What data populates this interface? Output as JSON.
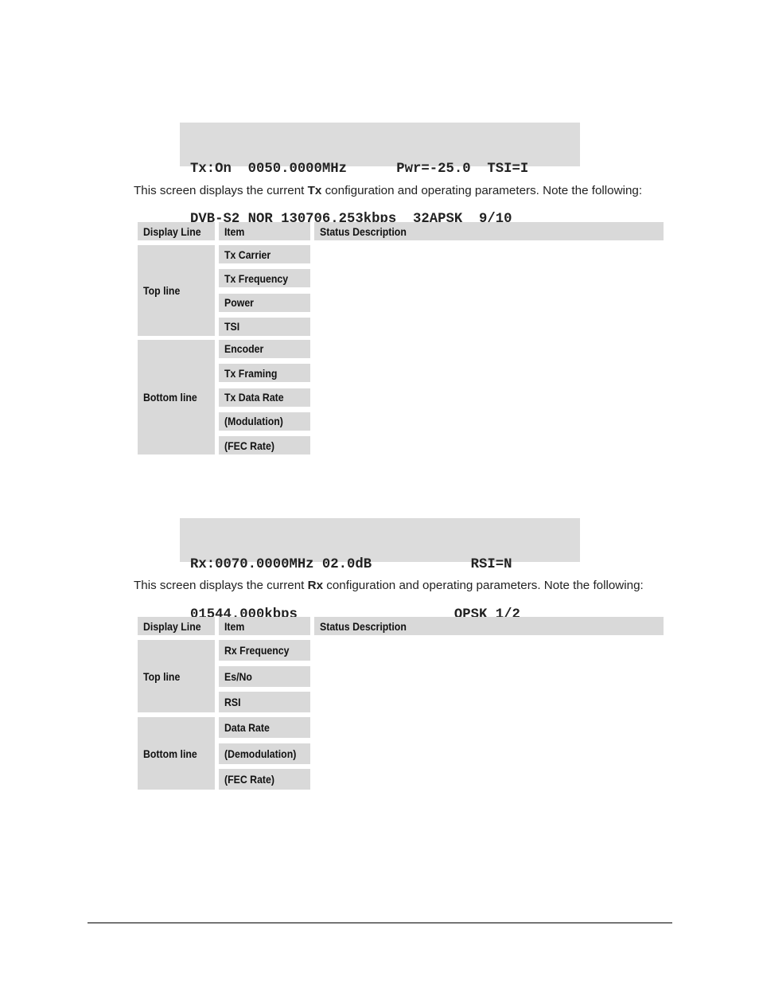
{
  "tx_screen": {
    "lcd_lines": [
      "Tx:On  0050.0000MHz      Pwr=-25.0  TSI=I",
      "DVB-S2 NOR 130706.253kbps  32APSK  9/10"
    ],
    "para_before": "This screen displays the current ",
    "para_bold": "Tx",
    "para_after": " configuration and operating parameters. Note the following:",
    "table": {
      "headers": [
        "Display Line",
        "Item",
        "Status Description"
      ],
      "groups": [
        {
          "display_line": "Top line",
          "items": [
            "Tx Carrier",
            "Tx Frequency",
            "Power",
            "TSI"
          ]
        },
        {
          "display_line": "Bottom line",
          "items": [
            "Encoder",
            "Tx Framing",
            "Tx Data Rate",
            "(Modulation)",
            "(FEC Rate)"
          ]
        }
      ]
    }
  },
  "rx_screen": {
    "lcd_lines": [
      "Rx:0070.0000MHz 02.0dB            RSI=N",
      "01544.000kbps                   QPSK 1/2"
    ],
    "para_before": "This screen displays the current ",
    "para_bold": "Rx",
    "para_after": " configuration and operating parameters. Note the following:",
    "table": {
      "headers": [
        "Display Line",
        "Item",
        "Status Description"
      ],
      "groups": [
        {
          "display_line": "Top line",
          "items": [
            "Rx Frequency",
            "Es/No",
            "RSI"
          ]
        },
        {
          "display_line": "Bottom line",
          "items": [
            "Data Rate",
            "(Demodulation)",
            "(FEC Rate)"
          ]
        }
      ]
    }
  }
}
